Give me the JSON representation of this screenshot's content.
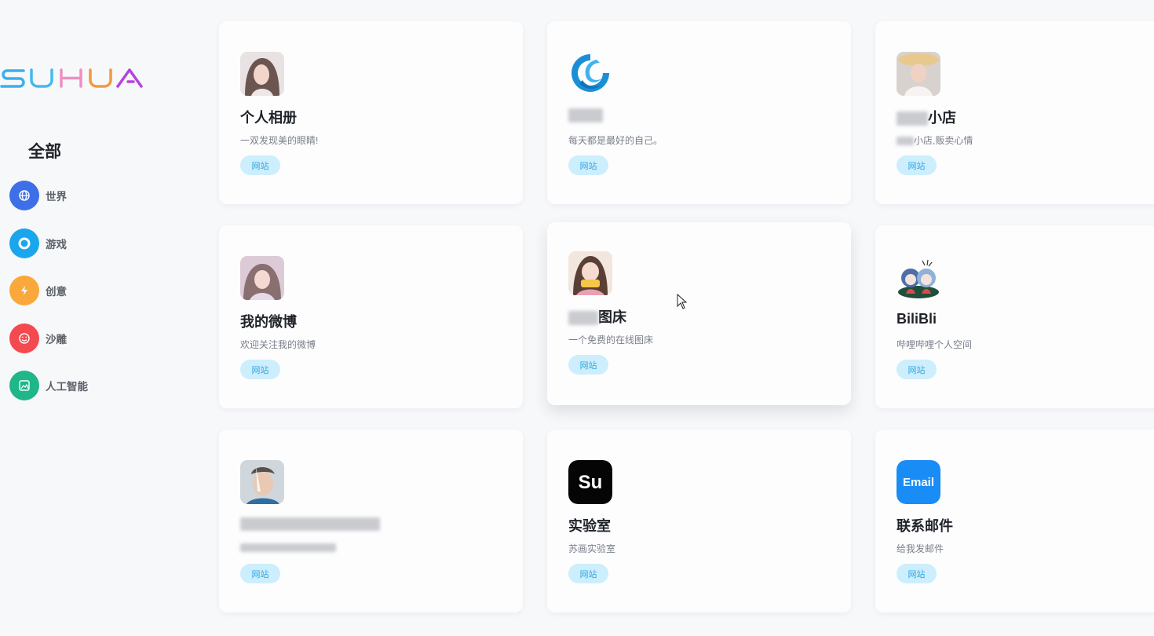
{
  "brand": {
    "logo_text": "SUHUA"
  },
  "sidebar": {
    "title": "全部",
    "items": [
      {
        "label": "世界",
        "icon": "globe-icon",
        "color": "#3d6fe8"
      },
      {
        "label": "游戏",
        "icon": "ring-icon",
        "color": "#1aa6ec"
      },
      {
        "label": "创意",
        "icon": "lightning-icon",
        "color": "#f9a93b"
      },
      {
        "label": "沙雕",
        "icon": "smile-icon",
        "color": "#f24a4f"
      },
      {
        "label": "人工智能",
        "icon": "image-icon",
        "color": "#1fb68a"
      }
    ]
  },
  "cards": [
    {
      "title": "个人相册",
      "desc": "一双发现美的眼睛!",
      "tag": "网站",
      "icon": "photo-avatar-icon"
    },
    {
      "title": "",
      "desc": "每天都是最好的自己。",
      "tag": "网站",
      "icon": "blue-swirl-logo-icon"
    },
    {
      "title": "小店",
      "desc": "小店,贩卖心情",
      "tag": "网站",
      "icon": "photo-avatar-icon"
    },
    {
      "title": "我的微博",
      "desc": "欢迎关注我的微博",
      "tag": "网站",
      "icon": "photo-avatar-icon"
    },
    {
      "title": "图床",
      "desc": "一个免费的在线图床",
      "tag": "网站",
      "icon": "photo-avatar-icon"
    },
    {
      "title": "BiliBli",
      "desc": "哔哩哔哩个人空间",
      "tag": "网站",
      "icon": "anime-character-icon"
    },
    {
      "title": "",
      "desc": "",
      "tag": "网站",
      "icon": "photo-avatar-icon"
    },
    {
      "title": "实验室",
      "desc": "苏画实验室",
      "tag": "网站",
      "icon": "su-logo-icon",
      "icon_text": "Su"
    },
    {
      "title": "联系邮件",
      "desc": "给我发邮件",
      "tag": "网站",
      "icon": "email-logo-icon",
      "icon_text": "Email"
    }
  ],
  "colors": {
    "tag_bg": "#cdeefc",
    "tag_text": "#2fa5e3",
    "page_bg": "#f7f8fa"
  }
}
